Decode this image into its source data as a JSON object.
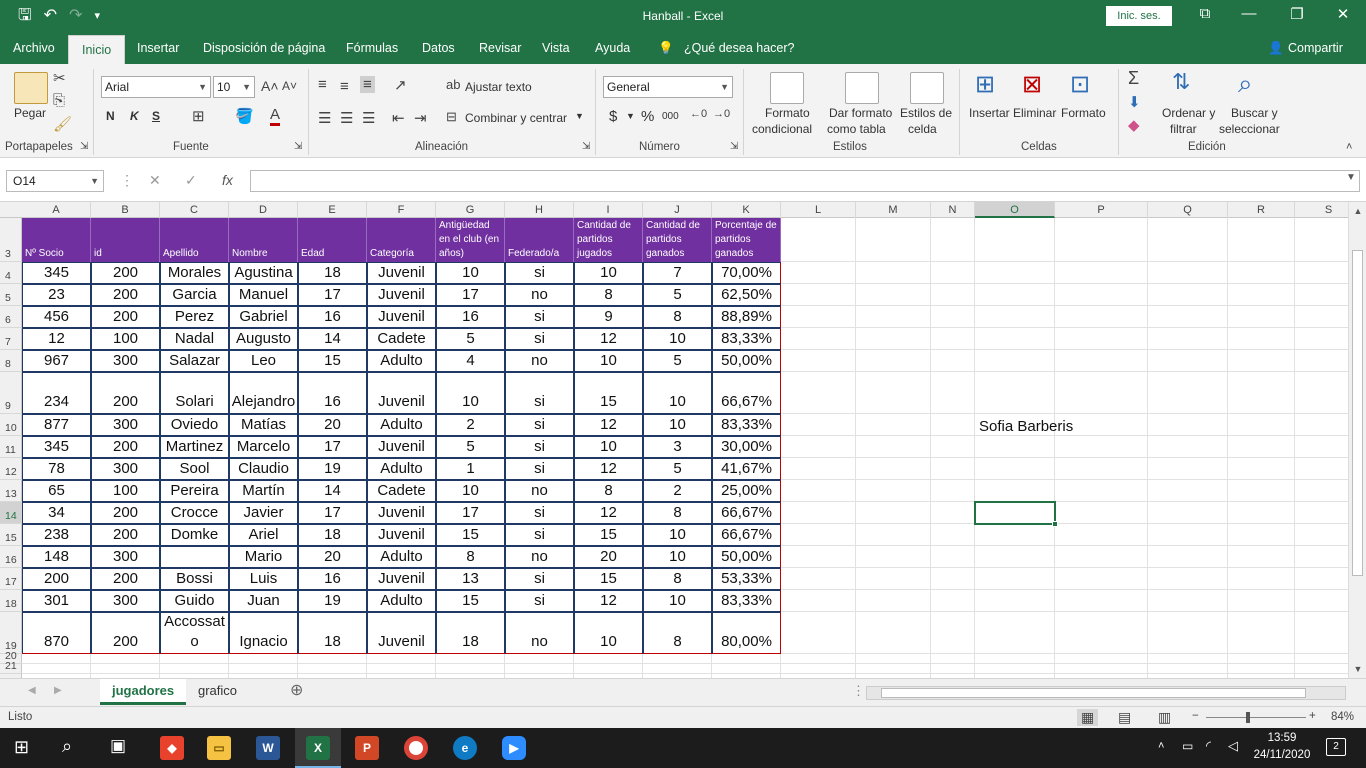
{
  "window": {
    "title": "Hanball  -  Excel",
    "signin_label": "Inic. ses."
  },
  "menu": {
    "tabs": [
      "Archivo",
      "Inicio",
      "Insertar",
      "Disposición de página",
      "Fórmulas",
      "Datos",
      "Revisar",
      "Vista",
      "Ayuda"
    ],
    "active_tab": "Inicio",
    "tell_me": "¿Qué desea hacer?",
    "share": "Compartir"
  },
  "ribbon": {
    "paste": "Pegar",
    "font_name": "Arial",
    "font_size": "10",
    "bold": "N",
    "italic": "K",
    "underline": "S",
    "wrap_text": "Ajustar texto",
    "merge_center": "Combinar y centrar",
    "number_format": "General",
    "currency": "$",
    "percent": "%",
    "thousands": "000",
    "conditional_1": "Formato",
    "conditional_2": "condicional",
    "table_1": "Dar formato",
    "table_2": "como tabla",
    "cellstyles_1": "Estilos de",
    "cellstyles_2": "celda",
    "insert": "Insertar",
    "delete": "Eliminar",
    "format": "Formato",
    "sort_1": "Ordenar y",
    "sort_2": "filtrar",
    "find_1": "Buscar y",
    "find_2": "seleccionar",
    "groups": {
      "clipboard": "Portapapeles",
      "font": "Fuente",
      "alignment": "Alineación",
      "number": "Número",
      "styles": "Estilos",
      "cells": "Celdas",
      "editing": "Edición"
    }
  },
  "formula_bar": {
    "name_box": "O14",
    "fx": "fx",
    "formula": ""
  },
  "columns": [
    "A",
    "B",
    "C",
    "D",
    "E",
    "F",
    "G",
    "H",
    "I",
    "J",
    "K",
    "L",
    "M",
    "N",
    "O",
    "P",
    "Q",
    "R",
    "S"
  ],
  "selected_column": "O",
  "rows": [
    "3",
    "4",
    "5",
    "6",
    "7",
    "8",
    "9",
    "10",
    "11",
    "12",
    "13",
    "14",
    "15",
    "16",
    "17",
    "18",
    "19",
    "20",
    "21"
  ],
  "selected_row": "14",
  "table": {
    "headers": [
      "Nº Socio",
      "id",
      "Apellido",
      "Nombre",
      "Edad",
      "Categoría",
      "Antigüedad en el club (en años)",
      "Federado/a",
      "Cantidad de partidos jugados",
      "Cantidad de partidos ganados",
      "Porcentaje de partidos ganados"
    ],
    "rows": [
      [
        "345",
        "200",
        "Morales",
        "Agustina",
        "18",
        "Juvenil",
        "10",
        "si",
        "10",
        "7",
        "70,00%"
      ],
      [
        "23",
        "200",
        "Garcia",
        "Manuel",
        "17",
        "Juvenil",
        "17",
        "no",
        "8",
        "5",
        "62,50%"
      ],
      [
        "456",
        "200",
        "Perez",
        "Gabriel",
        "16",
        "Juvenil",
        "16",
        "si",
        "9",
        "8",
        "88,89%"
      ],
      [
        "12",
        "100",
        "Nadal",
        "Augusto",
        "14",
        "Cadete",
        "5",
        "si",
        "12",
        "10",
        "83,33%"
      ],
      [
        "967",
        "300",
        "Salazar",
        "Leo",
        "15",
        "Adulto",
        "4",
        "no",
        "10",
        "5",
        "50,00%"
      ],
      [
        "234",
        "200",
        "Solari",
        "Alejandro",
        "16",
        "Juvenil",
        "10",
        "si",
        "15",
        "10",
        "66,67%"
      ],
      [
        "877",
        "300",
        "Oviedo",
        "Matías",
        "20",
        "Adulto",
        "2",
        "si",
        "12",
        "10",
        "83,33%"
      ],
      [
        "345",
        "200",
        "Martinez",
        "Marcelo",
        "17",
        "Juvenil",
        "5",
        "si",
        "10",
        "3",
        "30,00%"
      ],
      [
        "78",
        "300",
        "Sool",
        "Claudio",
        "19",
        "Adulto",
        "1",
        "si",
        "12",
        "5",
        "41,67%"
      ],
      [
        "65",
        "100",
        "Pereira",
        "Martín",
        "14",
        "Cadete",
        "10",
        "no",
        "8",
        "2",
        "25,00%"
      ],
      [
        "34",
        "200",
        "Crocce",
        "Javier",
        "17",
        "Juvenil",
        "17",
        "si",
        "12",
        "8",
        "66,67%"
      ],
      [
        "238",
        "200",
        "Domke",
        "Ariel",
        "18",
        "Juvenil",
        "15",
        "si",
        "15",
        "10",
        "66,67%"
      ],
      [
        "148",
        "300",
        "",
        "Mario",
        "20",
        "Adulto",
        "8",
        "no",
        "20",
        "10",
        "50,00%"
      ],
      [
        "200",
        "200",
        "Bossi",
        "Luis",
        "16",
        "Juvenil",
        "13",
        "si",
        "15",
        "8",
        "53,33%"
      ],
      [
        "301",
        "300",
        "Guido",
        "Juan",
        "19",
        "Adulto",
        "15",
        "si",
        "12",
        "10",
        "83,33%"
      ],
      [
        "870",
        "200",
        "Accossato",
        "Ignacio",
        "18",
        "Juvenil",
        "18",
        "no",
        "10",
        "8",
        "80,00%"
      ]
    ]
  },
  "extra_cell": "Sofia Barberis",
  "sheets": [
    "jugadores",
    "grafico"
  ],
  "active_sheet": "jugadores",
  "status": {
    "ready": "Listo",
    "zoom": "84%"
  },
  "taskbar": {
    "time": "13:59",
    "date": "24/11/2020",
    "notifications": "2"
  }
}
